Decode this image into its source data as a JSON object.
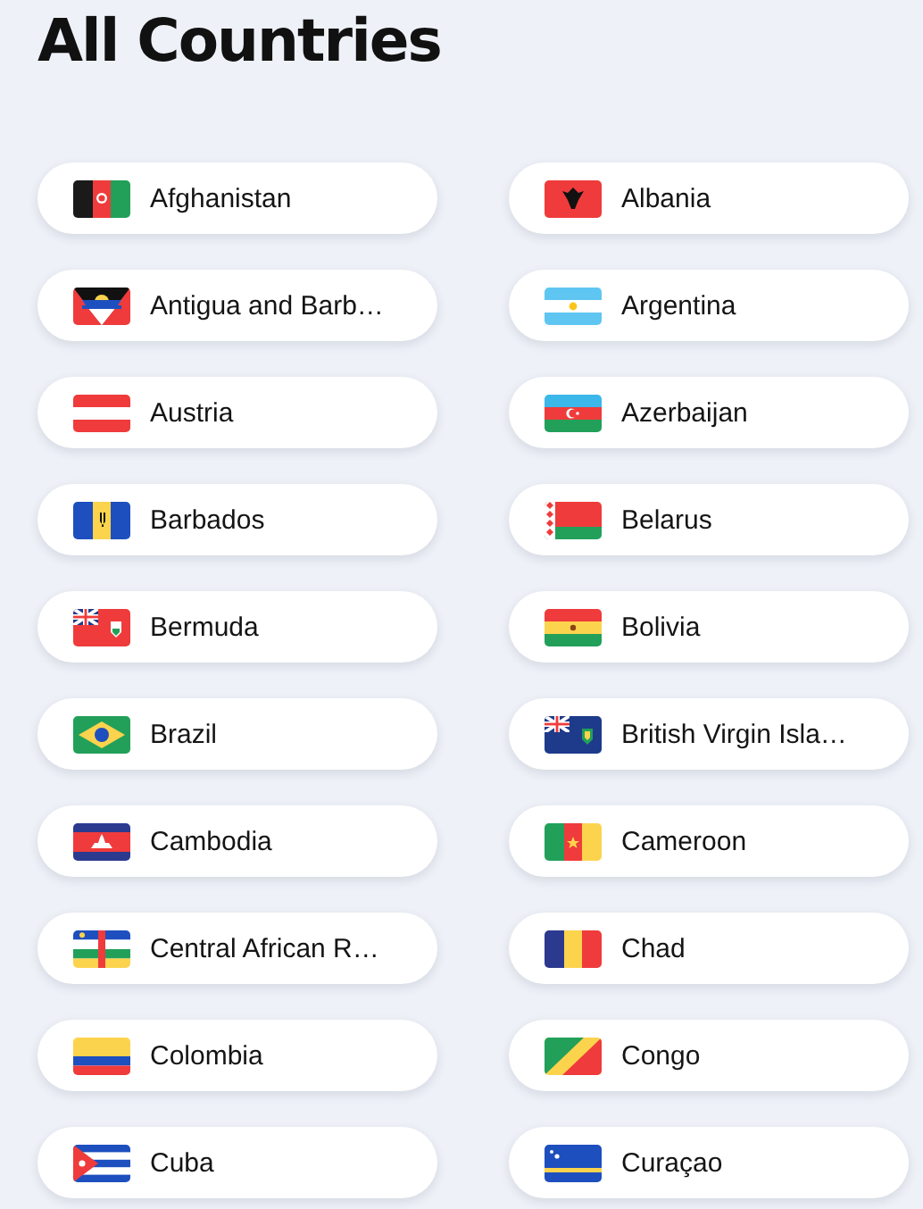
{
  "heading": "All Countries",
  "countries": [
    {
      "name": "Afghanistan"
    },
    {
      "name": "Albania"
    },
    {
      "name": "Antigua and Barb…"
    },
    {
      "name": "Argentina"
    },
    {
      "name": "Austria"
    },
    {
      "name": "Azerbaijan"
    },
    {
      "name": "Barbados"
    },
    {
      "name": "Belarus"
    },
    {
      "name": "Bermuda"
    },
    {
      "name": "Bolivia"
    },
    {
      "name": "Brazil"
    },
    {
      "name": "British Virgin Isla…"
    },
    {
      "name": "Cambodia"
    },
    {
      "name": "Cameroon"
    },
    {
      "name": "Central African R…"
    },
    {
      "name": "Chad"
    },
    {
      "name": "Colombia"
    },
    {
      "name": "Congo"
    },
    {
      "name": "Cuba"
    },
    {
      "name": "Curaçao"
    }
  ]
}
